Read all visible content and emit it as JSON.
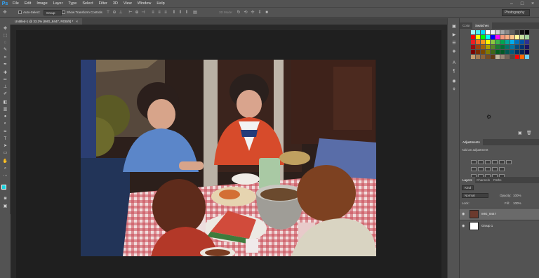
{
  "app": {
    "logo": "Ps"
  },
  "menu": [
    "File",
    "Edit",
    "Image",
    "Layer",
    "Type",
    "Select",
    "Filter",
    "3D",
    "View",
    "Window",
    "Help"
  ],
  "options_bar": {
    "auto_select_label": "Auto-Select:",
    "auto_select_value": "Group",
    "transform_label": "Show Transform Controls",
    "mode_3d_label": "3D Mode:",
    "workspace": "Photography"
  },
  "document": {
    "tab_title": "Untitled-1 @ 33.3% (IMG_8447, RGB/8) *",
    "close_glyph": "×"
  },
  "panels": {
    "color_tab": "Color",
    "swatches_tab": "Swatches",
    "adjustments_tab": "Adjustments",
    "adjustments_hint": "Add an adjustment",
    "layers_tab": "Layers",
    "channels_tab": "Channels",
    "paths_tab": "Paths",
    "kind_filter": "Kind",
    "blend_mode": "Normal",
    "opacity_label": "Opacity:",
    "opacity_value": "100%",
    "lock_label": "Lock:",
    "fill_label": "Fill:",
    "fill_value": "100%",
    "layers": [
      {
        "name": "IMG_8447",
        "visible": true,
        "selected": true
      },
      {
        "name": "Group 1",
        "visible": true,
        "selected": false
      }
    ]
  },
  "colors": {
    "foreground": "#19d4e0",
    "background": "#111111",
    "swatch_rows": [
      [
        "#9ef7f7",
        "#48f0f0",
        "#00d8ff",
        "#ffffff",
        "#efefef",
        "#cfcfcf",
        "#a8a8a8",
        "#888",
        "#606060",
        "#3a3a3a",
        "#111",
        "#000"
      ],
      [
        "#ff0000",
        "#ffff00",
        "#00ff00",
        "#00ffff",
        "#0000ff",
        "#ff00ff",
        "#f7977a",
        "#f9ad81",
        "#fdc68a",
        "#fff79a",
        "#c4df9b",
        "#a3d39c"
      ],
      [
        "#ed1c24",
        "#f26522",
        "#f7941d",
        "#fff200",
        "#8dc63f",
        "#39b54a",
        "#00a651",
        "#00a99d",
        "#00aeef",
        "#0072bc",
        "#0054a6",
        "#2e3192"
      ],
      [
        "#9e0b0f",
        "#a0410d",
        "#a36209",
        "#aba000",
        "#598527",
        "#1a7b30",
        "#007236",
        "#00746b",
        "#0076a3",
        "#004b80",
        "#003471",
        "#1b1464"
      ],
      [
        "#790000",
        "#7b2e00",
        "#7d4900",
        "#827b00",
        "#406618",
        "#005e20",
        "#005826",
        "#005952",
        "#005b7f",
        "#003663",
        "#002157",
        "#0d004c"
      ],
      [
        "#c69c6d",
        "#a67c52",
        "#8c6239",
        "#754c24",
        "#603913",
        "#c2b59b",
        "#998675",
        "#736357",
        "#534741",
        "#ff0000",
        "#ff6600",
        "#6dcff6"
      ]
    ]
  }
}
